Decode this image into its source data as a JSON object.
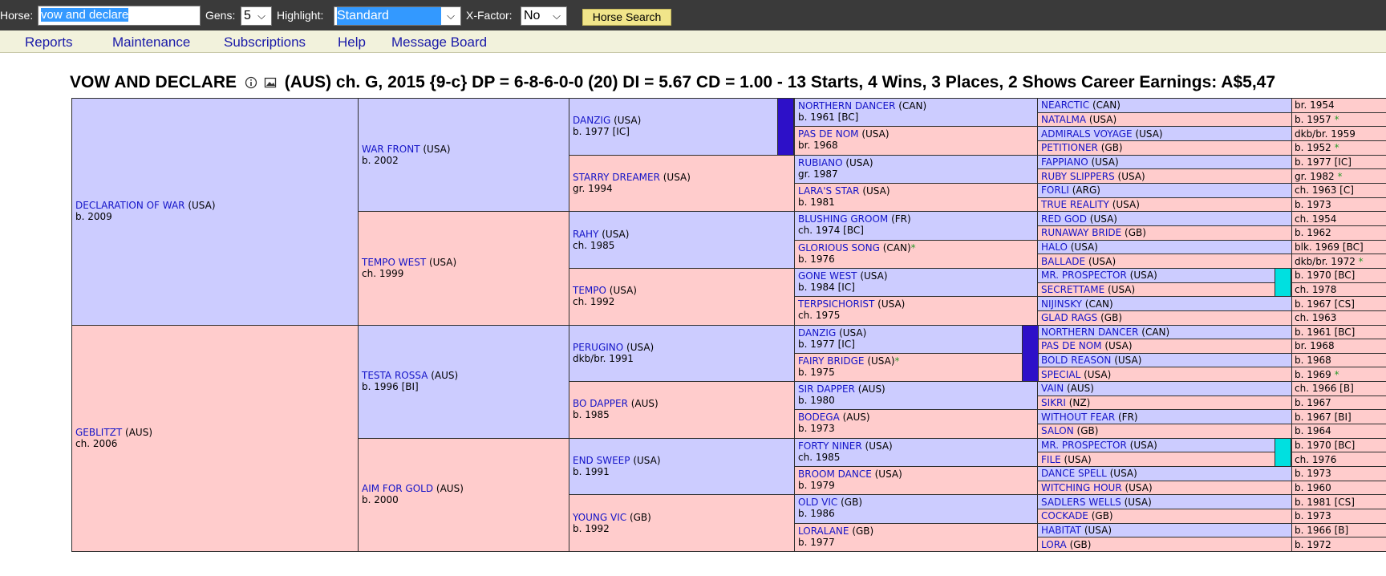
{
  "toolbar": {
    "horse_label": "Horse:",
    "horse_value": "vow and declare",
    "gens_label": "Gens:",
    "gens_value": "5",
    "highlight_label": "Highlight:",
    "highlight_value": "Standard",
    "xfactor_label": "X-Factor:",
    "xfactor_value": "No",
    "search_button": "Horse Search"
  },
  "menu": [
    "Reports",
    "Maintenance",
    "Subscriptions",
    "Help",
    "Message Board"
  ],
  "headline": {
    "name": "VOW AND DECLARE",
    "rest": "(AUS) ch. G, 2015 {9-c} DP = 6-8-6-0-0 (20) DI = 5.67   CD = 1.00 - 13 Starts, 4 Wins, 3 Places, 2 Shows Career Earnings: A$5,47"
  },
  "colors": {
    "male": "#ccccff",
    "female": "#ffcccc",
    "link": "#1414c8",
    "dosage_mark": "#2d10c8",
    "inbreed_mark": "#00e0e0"
  },
  "gen1": [
    {
      "name": "DECLARATION OF WAR",
      "ctry": "(USA)",
      "info": "b. 2009"
    },
    {
      "name": "GEBLITZT",
      "ctry": "(AUS)",
      "info": "ch. 2006"
    }
  ],
  "gen2": [
    {
      "name": "WAR FRONT",
      "ctry": "(USA)",
      "info": "b. 2002"
    },
    {
      "name": "TEMPO WEST",
      "ctry": "(USA)",
      "info": "ch. 1999"
    },
    {
      "name": "TESTA ROSSA",
      "ctry": "(AUS)",
      "info": "b. 1996 [BI]"
    },
    {
      "name": "AIM FOR GOLD",
      "ctry": "(AUS)",
      "info": "b. 2000"
    }
  ],
  "gen3": [
    {
      "name": "DANZIG",
      "ctry": "(USA)",
      "info": "b. 1977 [IC]"
    },
    {
      "name": "STARRY DREAMER",
      "ctry": "(USA)",
      "info": "gr. 1994"
    },
    {
      "name": "RAHY",
      "ctry": "(USA)",
      "info": "ch. 1985"
    },
    {
      "name": "TEMPO",
      "ctry": "(USA)",
      "info": "ch. 1992"
    },
    {
      "name": "PERUGINO",
      "ctry": "(USA)",
      "info": "dkb/br. 1991"
    },
    {
      "name": "BO DAPPER",
      "ctry": "(AUS)",
      "info": "b. 1985"
    },
    {
      "name": "END SWEEP",
      "ctry": "(USA)",
      "info": "b. 1991"
    },
    {
      "name": "YOUNG VIC",
      "ctry": "(GB)",
      "info": "b. 1992"
    }
  ],
  "gen4": [
    {
      "name": "NORTHERN DANCER",
      "ctry": "(CAN)",
      "info": "b. 1961 [BC]"
    },
    {
      "name": "PAS DE NOM",
      "ctry": "(USA)",
      "info": "br. 1968"
    },
    {
      "name": "RUBIANO",
      "ctry": "(USA)",
      "info": "gr. 1987"
    },
    {
      "name": "LARA'S STAR",
      "ctry": "(USA)",
      "info": "b. 1981"
    },
    {
      "name": "BLUSHING GROOM",
      "ctry": "(FR)",
      "info": "ch. 1974 [BC]"
    },
    {
      "name": "GLORIOUS SONG",
      "ctry": "(CAN)",
      "star": "*",
      "info": "b. 1976"
    },
    {
      "name": "GONE WEST",
      "ctry": "(USA)",
      "info": "b. 1984 [IC]"
    },
    {
      "name": "TERPSICHORIST",
      "ctry": "(USA)",
      "info": "ch. 1975"
    },
    {
      "name": "DANZIG",
      "ctry": "(USA)",
      "info": "b. 1977 [IC]"
    },
    {
      "name": "FAIRY BRIDGE",
      "ctry": "(USA)",
      "star": "*",
      "info": "b. 1975"
    },
    {
      "name": "SIR DAPPER",
      "ctry": "(AUS)",
      "info": "b. 1980"
    },
    {
      "name": "BODEGA",
      "ctry": "(AUS)",
      "info": "b. 1973"
    },
    {
      "name": "FORTY NINER",
      "ctry": "(USA)",
      "info": "ch. 1985"
    },
    {
      "name": "BROOM DANCE",
      "ctry": "(USA)",
      "info": "b. 1979"
    },
    {
      "name": "OLD VIC",
      "ctry": "(GB)",
      "info": "b. 1986"
    },
    {
      "name": "LORALANE",
      "ctry": "(GB)",
      "info": "b. 1977"
    }
  ],
  "gen5": [
    {
      "name": "NEARCTIC",
      "ctry": "(CAN)",
      "info": "br. 1954"
    },
    {
      "name": "NATALMA",
      "ctry": "(USA)",
      "info": "b. 1957",
      "star": "*"
    },
    {
      "name": "ADMIRALS VOYAGE",
      "ctry": "(USA)",
      "info": "dkb/br. 1959"
    },
    {
      "name": "PETITIONER",
      "ctry": "(GB)",
      "info": "b. 1952",
      "star": "*"
    },
    {
      "name": "FAPPIANO",
      "ctry": "(USA)",
      "info": "b. 1977 [IC]"
    },
    {
      "name": "RUBY SLIPPERS",
      "ctry": "(USA)",
      "info": "gr. 1982",
      "star": "*"
    },
    {
      "name": "FORLI",
      "ctry": "(ARG)",
      "info": "ch. 1963 [C]"
    },
    {
      "name": "TRUE REALITY",
      "ctry": "(USA)",
      "info": "b. 1973"
    },
    {
      "name": "RED GOD",
      "ctry": "(USA)",
      "info": "ch. 1954"
    },
    {
      "name": "RUNAWAY BRIDE",
      "ctry": "(GB)",
      "info": "b. 1962"
    },
    {
      "name": "HALO",
      "ctry": "(USA)",
      "info": "blk. 1969 [BC]"
    },
    {
      "name": "BALLADE",
      "ctry": "(USA)",
      "info": "dkb/br. 1972",
      "star": "*"
    },
    {
      "name": "MR. PROSPECTOR",
      "ctry": "(USA)",
      "info": "b. 1970 [BC]"
    },
    {
      "name": "SECRETTAME",
      "ctry": "(USA)",
      "info": "ch. 1978"
    },
    {
      "name": "NIJINSKY",
      "ctry": "(CAN)",
      "info": "b. 1967 [CS]"
    },
    {
      "name": "GLAD RAGS",
      "ctry": "(GB)",
      "info": "ch. 1963"
    },
    {
      "name": "NORTHERN DANCER",
      "ctry": "(CAN)",
      "info": "b. 1961 [BC]"
    },
    {
      "name": "PAS DE NOM",
      "ctry": "(USA)",
      "info": "br. 1968"
    },
    {
      "name": "BOLD REASON",
      "ctry": "(USA)",
      "info": "b. 1968"
    },
    {
      "name": "SPECIAL",
      "ctry": "(USA)",
      "info": "b. 1969",
      "star": "*"
    },
    {
      "name": "VAIN",
      "ctry": "(AUS)",
      "info": "ch. 1966 [B]"
    },
    {
      "name": "SIKRI",
      "ctry": "(NZ)",
      "info": "b. 1967"
    },
    {
      "name": "WITHOUT FEAR",
      "ctry": "(FR)",
      "info": "b. 1967 [BI]"
    },
    {
      "name": "SALON",
      "ctry": "(GB)",
      "info": "b. 1964"
    },
    {
      "name": "MR. PROSPECTOR",
      "ctry": "(USA)",
      "info": "b. 1970 [BC]"
    },
    {
      "name": "FILE",
      "ctry": "(USA)",
      "info": "ch. 1976"
    },
    {
      "name": "DANCE SPELL",
      "ctry": "(USA)",
      "info": "b. 1973"
    },
    {
      "name": "WITCHING HOUR",
      "ctry": "(USA)",
      "info": "b. 1960"
    },
    {
      "name": "SADLERS WELLS",
      "ctry": "(USA)",
      "info": "b. 1981 [CS]"
    },
    {
      "name": "COCKADE",
      "ctry": "(GB)",
      "info": "b. 1973"
    },
    {
      "name": "HABITAT",
      "ctry": "(USA)",
      "info": "b. 1966 [B]"
    },
    {
      "name": "LORA",
      "ctry": "(GB)",
      "info": "b. 1972"
    }
  ]
}
